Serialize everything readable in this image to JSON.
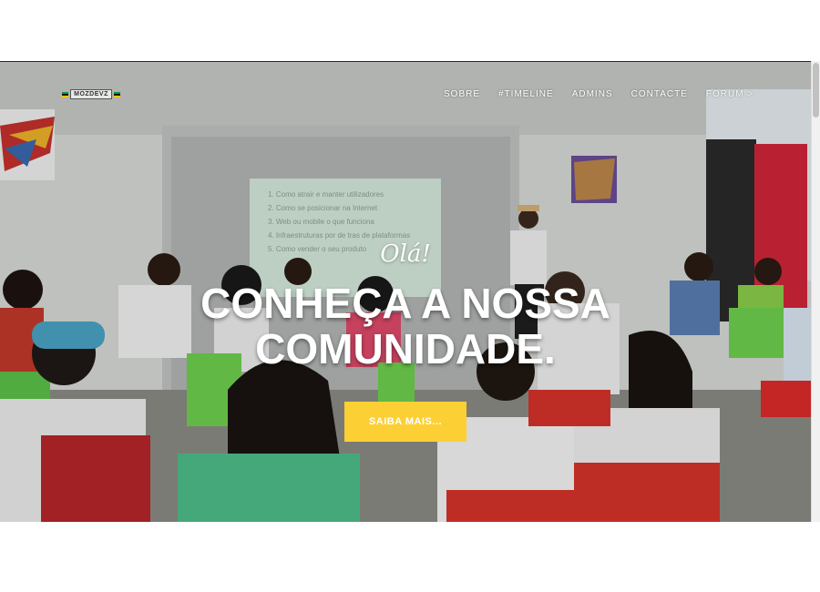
{
  "logo": {
    "text": "MOZDEVZ"
  },
  "nav": {
    "items": [
      "SOBRE",
      "#TIMELINE",
      "ADMINS",
      "CONTACTE",
      "FORUM >"
    ]
  },
  "hero": {
    "greeting": "Olá!",
    "headline_line1": "CONHEÇA A NOSSA",
    "headline_line2": "COMUNIDADE.",
    "cta_label": "SAIBA MAIS...",
    "cta_color": "#fcd034"
  },
  "projection": {
    "items": [
      "1. Como atrair e manter utilizadores",
      "2. Como se posicionar na Internet",
      "3. Web ou mobile o que funciona",
      "4. Infraestruturas por de tras de plataformas",
      "5. Como vender o seu produto"
    ]
  }
}
